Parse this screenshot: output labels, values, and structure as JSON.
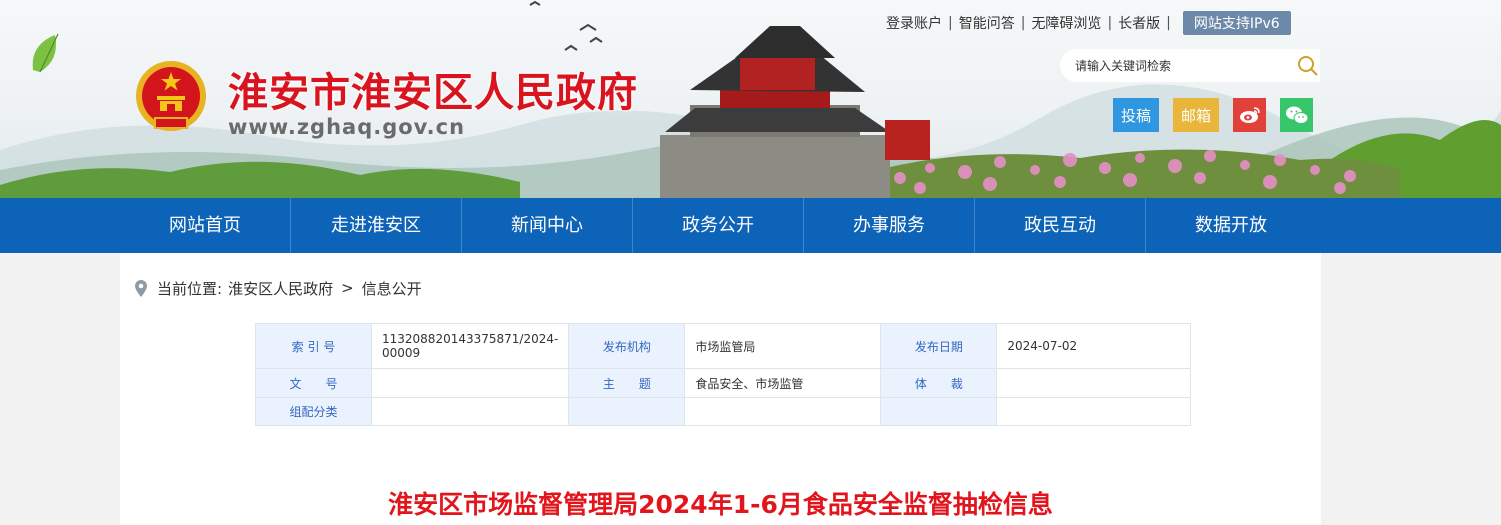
{
  "header": {
    "site_name": "淮安市淮安区人民政府",
    "site_url": "www.zghaq.gov.cn",
    "top_links": [
      "登录账户",
      "智能问答",
      "无障碍浏览",
      "长者版"
    ],
    "ipv6_label": "网站支持IPv6",
    "search": {
      "placeholder": "请输入关键词检索"
    },
    "quick": {
      "tougao": "投稿",
      "youxiang": "邮箱"
    }
  },
  "nav": {
    "items": [
      "网站首页",
      "走进淮安区",
      "新闻中心",
      "政务公开",
      "办事服务",
      "政民互动",
      "数据开放"
    ]
  },
  "breadcrumb": {
    "label": "当前位置:",
    "items": [
      "淮安区人民政府",
      "信息公开"
    ],
    "separator": ">"
  },
  "meta_table": {
    "index_label": "索 引 号",
    "index_value": "113208820143375871/2024-00009",
    "publisher_label": "发布机构",
    "publisher_value": "市场监管局",
    "date_label": "发布日期",
    "date_value": "2024-07-02",
    "docno_label": "文　　号",
    "docno_value": "",
    "topic_label": "主　　题",
    "topic_value": "食品安全、市场监管",
    "genre_label": "体　　裁",
    "genre_value": "",
    "category_label": "组配分类",
    "category_value": ""
  },
  "article": {
    "title": "淮安区市场监督管理局2024年1-6月食品安全监督抽检信息"
  },
  "colors": {
    "nav_bg": "#0d63b7",
    "title_red": "#e2151d",
    "site_name_red": "#d9141f",
    "table_key_bg": "#e9f2fd",
    "ipv6_bg": "#6c89aa"
  }
}
